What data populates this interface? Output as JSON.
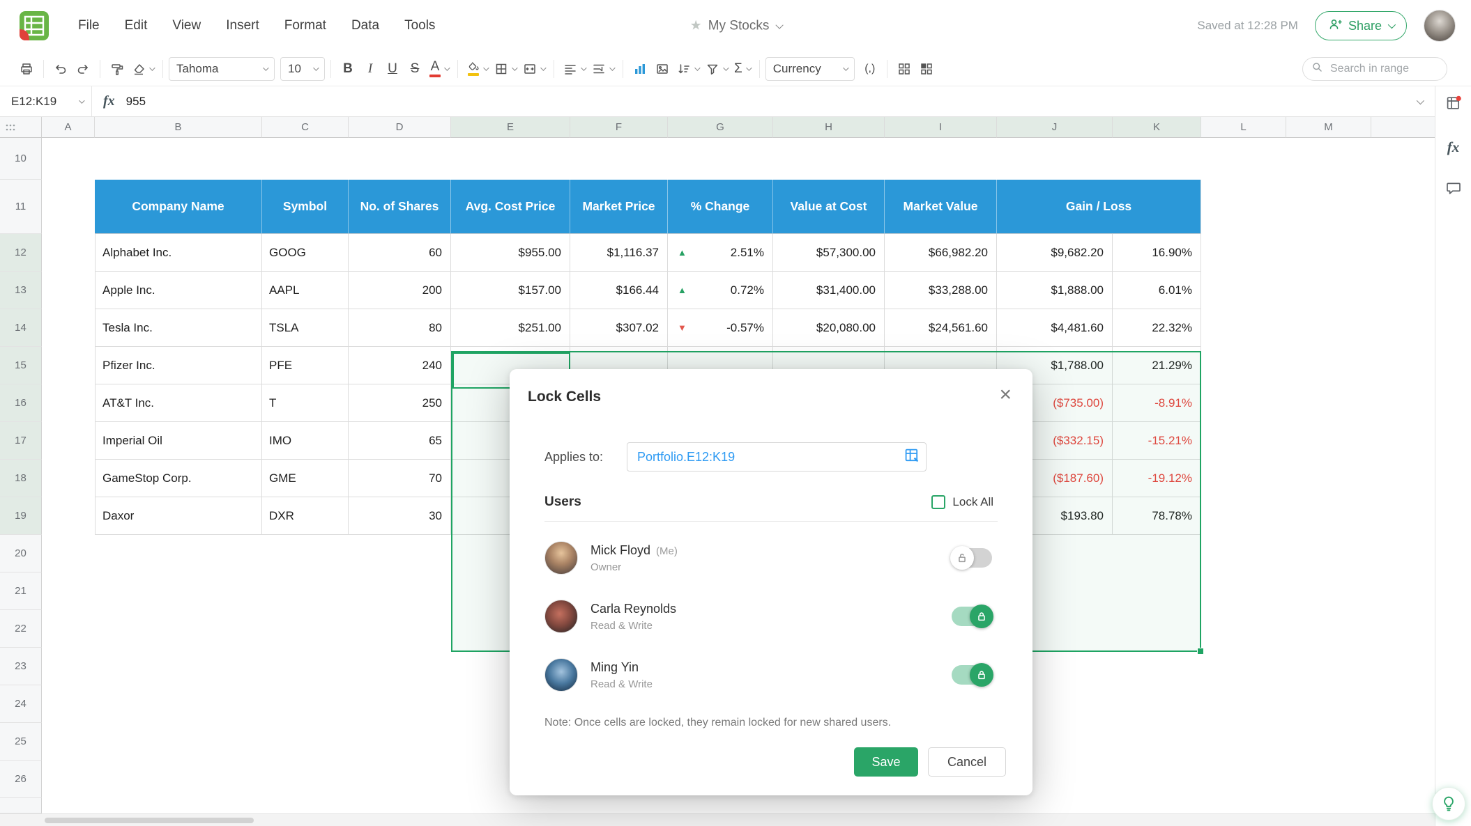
{
  "menubar": {
    "items": [
      "File",
      "Edit",
      "View",
      "Insert",
      "Format",
      "Data",
      "Tools"
    ],
    "doc_title": "My Stocks",
    "saved_status": "Saved at 12:28 PM",
    "share_label": "Share"
  },
  "toolbar": {
    "font_family": "Tahoma",
    "font_size": "10",
    "bold": "B",
    "italic": "I",
    "underline": "U",
    "strike": "S",
    "text_color": "A",
    "sum": "Σ",
    "number_format": "(,)",
    "format_name": "Currency",
    "search_placeholder": "Search in range"
  },
  "formula_bar": {
    "cell_ref": "E12:K19",
    "fx": "fx",
    "value": "955"
  },
  "grid": {
    "column_letters": [
      "A",
      "B",
      "C",
      "D",
      "E",
      "F",
      "G",
      "H",
      "I",
      "J",
      "K",
      "L",
      "M"
    ],
    "row_numbers": [
      10,
      11,
      12,
      13,
      14,
      15,
      16,
      17,
      18,
      19,
      20,
      21,
      22,
      23,
      24,
      25,
      26
    ],
    "selected_columns": [
      "E",
      "F",
      "G",
      "H",
      "I",
      "J",
      "K"
    ],
    "selected_rows": [
      12,
      13,
      14,
      15,
      16,
      17,
      18,
      19
    ],
    "selection_range": "E12:K19",
    "active_cell": "E12"
  },
  "sheet_table": {
    "headers": [
      "Company Name",
      "Symbol",
      "No. of Shares",
      "Avg. Cost Price",
      "Market Price",
      "% Change",
      "Value at Cost",
      "Market Value",
      "Gain / Loss"
    ],
    "rows": [
      {
        "company": "Alphabet Inc.",
        "symbol": "GOOG",
        "shares": "60",
        "avg_cost_price": "$955.00",
        "market_price": "$1,116.37",
        "trend": "up",
        "pct_change": "2.51%",
        "value_at_cost": "$57,300.00",
        "market_value": "$66,982.20",
        "gain_loss": "$9,682.20",
        "gain_loss_pct": "16.90%",
        "loss": false
      },
      {
        "company": "Apple Inc.",
        "symbol": "AAPL",
        "shares": "200",
        "avg_cost_price": "$157.00",
        "market_price": "$166.44",
        "trend": "up",
        "pct_change": "0.72%",
        "value_at_cost": "$31,400.00",
        "market_value": "$33,288.00",
        "gain_loss": "$1,888.00",
        "gain_loss_pct": "6.01%",
        "loss": false
      },
      {
        "company": "Tesla Inc.",
        "symbol": "TSLA",
        "shares": "80",
        "avg_cost_price": "$251.00",
        "market_price": "$307.02",
        "trend": "down",
        "pct_change": "-0.57%",
        "value_at_cost": "$20,080.00",
        "market_value": "$24,561.60",
        "gain_loss": "$4,481.60",
        "gain_loss_pct": "22.32%",
        "loss": false
      },
      {
        "company": "Pfizer Inc.",
        "symbol": "PFE",
        "shares": "240",
        "avg_cost_price": "",
        "market_price": "",
        "trend": "",
        "pct_change": "",
        "value_at_cost": "",
        "market_value": "",
        "gain_loss": "$1,788.00",
        "gain_loss_pct": "21.29%",
        "loss": false
      },
      {
        "company": "AT&T Inc.",
        "symbol": "T",
        "shares": "250",
        "avg_cost_price": "",
        "market_price": "",
        "trend": "",
        "pct_change": "",
        "value_at_cost": "",
        "market_value": "",
        "gain_loss": "($735.00)",
        "gain_loss_pct": "-8.91%",
        "loss": true
      },
      {
        "company": "Imperial Oil",
        "symbol": "IMO",
        "shares": "65",
        "avg_cost_price": "",
        "market_price": "",
        "trend": "",
        "pct_change": "",
        "value_at_cost": "",
        "market_value": "",
        "gain_loss": "($332.15)",
        "gain_loss_pct": "-15.21%",
        "loss": true
      },
      {
        "company": "GameStop Corp.",
        "symbol": "GME",
        "shares": "70",
        "avg_cost_price": "",
        "market_price": "",
        "trend": "",
        "pct_change": "",
        "value_at_cost": "",
        "market_value": "",
        "gain_loss": "($187.60)",
        "gain_loss_pct": "-19.12%",
        "loss": true
      },
      {
        "company": "Daxor",
        "symbol": "DXR",
        "shares": "30",
        "avg_cost_price": "",
        "market_price": "",
        "trend": "",
        "pct_change": "",
        "value_at_cost": "",
        "market_value": "",
        "gain_loss": "$193.80",
        "gain_loss_pct": "78.78%",
        "loss": false
      }
    ]
  },
  "dialog": {
    "title": "Lock Cells",
    "applies_to_label": "Applies to:",
    "applies_to_value": "Portfolio.E12:K19",
    "users_label": "Users",
    "lock_all_label": "Lock All",
    "users": [
      {
        "name": "Mick Floyd",
        "me_tag": "(Me)",
        "role": "Owner",
        "locked": false
      },
      {
        "name": "Carla Reynolds",
        "me_tag": "",
        "role": "Read & Write",
        "locked": true
      },
      {
        "name": "Ming Yin",
        "me_tag": "",
        "role": "Read & Write",
        "locked": true
      }
    ],
    "note": "Note:  Once cells are locked, they remain locked for new shared users.",
    "save_label": "Save",
    "cancel_label": "Cancel"
  },
  "colors": {
    "accent_green": "#2AA567",
    "selection_green": "#1FA463",
    "header_blue": "#2B98D8",
    "negative_red": "#E8423C",
    "link_blue": "#2F9BF3"
  }
}
